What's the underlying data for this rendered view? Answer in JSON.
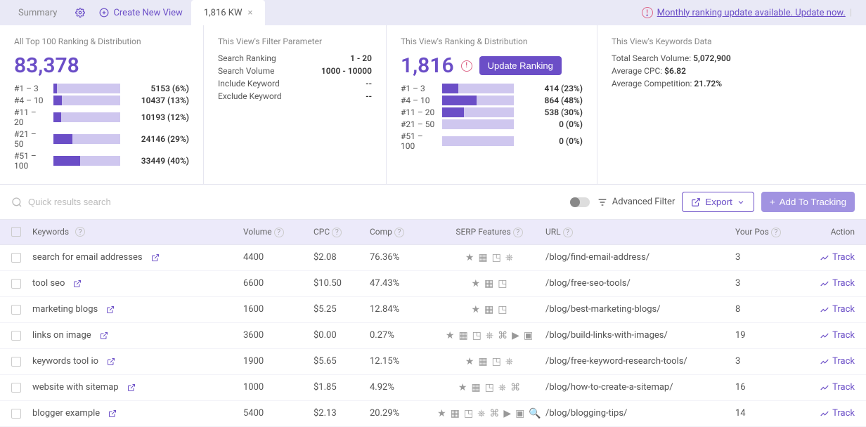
{
  "tabs": {
    "summary": "Summary",
    "create": "Create New View",
    "current": "1,816 KW"
  },
  "update_notice": "Monthly ranking update available. Update now.",
  "panel1": {
    "title": "All Top 100 Ranking & Distribution",
    "total": "83,378",
    "dist": [
      {
        "label": "#1 – 3",
        "fill": 6,
        "value": "5153 (6%)"
      },
      {
        "label": "#4 – 10",
        "fill": 13,
        "value": "10437 (13%)"
      },
      {
        "label": "#11 – 20",
        "fill": 12,
        "value": "10193 (12%)"
      },
      {
        "label": "#21 – 50",
        "fill": 29,
        "value": "24146 (29%)"
      },
      {
        "label": "#51 – 100",
        "fill": 40,
        "value": "33449 (40%)"
      }
    ]
  },
  "panel2": {
    "title": "This View's Filter Parameter",
    "params": [
      {
        "k": "Search Ranking",
        "v": "1 - 20"
      },
      {
        "k": "Search Volume",
        "v": "1000 - 10000"
      },
      {
        "k": "Include Keyword",
        "v": "--"
      },
      {
        "k": "Exclude Keyword",
        "v": "--"
      }
    ]
  },
  "panel3": {
    "title": "This View's Ranking & Distribution",
    "total": "1,816",
    "btn": "Update Ranking",
    "dist": [
      {
        "label": "#1 – 3",
        "fill": 23,
        "value": "414 (23%)"
      },
      {
        "label": "#4 – 10",
        "fill": 48,
        "value": "864 (48%)"
      },
      {
        "label": "#11 – 20",
        "fill": 30,
        "value": "538 (30%)"
      },
      {
        "label": "#21 – 50",
        "fill": 0,
        "value": "0 (0%)"
      },
      {
        "label": "#51 – 100",
        "fill": 0,
        "value": "0 (0%)"
      }
    ]
  },
  "panel4": {
    "title": "This View's Keywords Data",
    "rows": [
      {
        "k": "Total Search Volume:",
        "v": "5,072,900"
      },
      {
        "k": "Average CPC:",
        "v": "$6.82"
      },
      {
        "k": "Average Competition:",
        "v": "21.72%"
      }
    ]
  },
  "toolbar": {
    "search_placeholder": "Quick results search",
    "adv_filter": "Advanced Filter",
    "export": "Export",
    "add_tracking": "Add To Tracking"
  },
  "columns": {
    "kw": "Keywords",
    "vol": "Volume",
    "cpc": "CPC",
    "comp": "Comp",
    "serp": "SERP Features",
    "url": "URL",
    "pos": "Your Pos",
    "act": "Action"
  },
  "rows": [
    {
      "kw": "search for email addresses",
      "vol": "4400",
      "cpc": "$2.08",
      "comp": "76.36%",
      "serp": 4,
      "url": "/blog/find-email-address/",
      "pos": "3"
    },
    {
      "kw": "tool seo",
      "vol": "6600",
      "cpc": "$10.50",
      "comp": "47.43%",
      "serp": 3,
      "url": "/blog/free-seo-tools/",
      "pos": "3"
    },
    {
      "kw": "marketing blogs",
      "vol": "1600",
      "cpc": "$5.25",
      "comp": "12.84%",
      "serp": 3,
      "url": "/blog/best-marketing-blogs/",
      "pos": "8"
    },
    {
      "kw": "links on image",
      "vol": "3600",
      "cpc": "$0.00",
      "comp": "0.27%",
      "serp": 7,
      "url": "/blog/build-links-with-images/",
      "pos": "19"
    },
    {
      "kw": "keywords tool io",
      "vol": "1900",
      "cpc": "$5.65",
      "comp": "12.15%",
      "serp": 4,
      "url": "/blog/free-keyword-research-tools/",
      "pos": "3"
    },
    {
      "kw": "website with sitemap",
      "vol": "1000",
      "cpc": "$1.85",
      "comp": "4.92%",
      "serp": 5,
      "url": "/blog/how-to-create-a-sitemap/",
      "pos": "16"
    },
    {
      "kw": "blogger example",
      "vol": "5400",
      "cpc": "$2.13",
      "comp": "20.29%",
      "serp": 8,
      "url": "/blog/blogging-tips/",
      "pos": "14"
    }
  ],
  "track_label": "Track"
}
